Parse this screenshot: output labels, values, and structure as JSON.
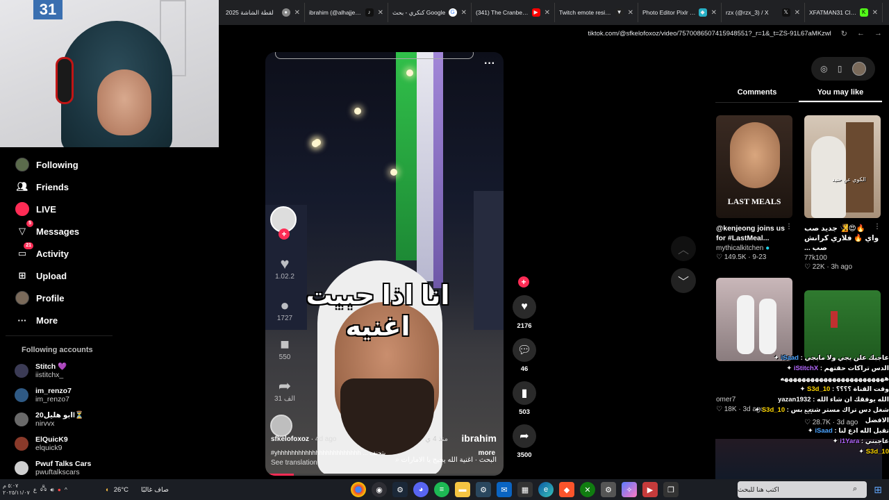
{
  "browser": {
    "tabs": [
      {
        "label": "لقطة الشاشة 2025",
        "icon": "chrome-icon",
        "color": "#888"
      },
      {
        "label": "ibrahim (@alhajjeri) |",
        "icon": "tiktok-icon",
        "color": "#111"
      },
      {
        "label": "كنكري - بحث Google",
        "icon": "google-icon",
        "color": "#4285f4"
      },
      {
        "label": "(341) The Cranberries",
        "icon": "youtube-icon",
        "color": "#ff0000"
      },
      {
        "label": "Twitch emote resizer",
        "icon": "resizer-icon",
        "color": "#111"
      },
      {
        "label": "Photo Editor Pixlr Free",
        "icon": "pixlr-icon",
        "color": "#27b0c6"
      },
      {
        "label": "rzx (@rzx_3) / X",
        "icon": "x-icon",
        "color": "#111"
      },
      {
        "label": "XFATMAN31 Clips - K",
        "icon": "kick-icon",
        "color": "#53fc18"
      }
    ],
    "url": "tiktok.com/@sfkelofoxoz/video/7570086507415948551?_r=1&_t=ZS-91L67aMKzwl"
  },
  "webcam": {
    "door_number": "31"
  },
  "sidebar": {
    "nav": [
      {
        "label": "Following",
        "icon": "following-avatar-icon",
        "badge": ""
      },
      {
        "label": "Friends",
        "icon": "friends-icon",
        "badge": ""
      },
      {
        "label": "LIVE",
        "icon": "live-icon",
        "badge": ""
      },
      {
        "label": "Messages",
        "icon": "messages-icon",
        "badge": "5"
      },
      {
        "label": "Activity",
        "icon": "activity-icon",
        "badge": "21"
      },
      {
        "label": "Upload",
        "icon": "upload-icon",
        "badge": ""
      },
      {
        "label": "Profile",
        "icon": "profile-avatar-icon",
        "badge": ""
      },
      {
        "label": "More",
        "icon": "more-icon",
        "badge": ""
      }
    ],
    "following_title": "Following accounts",
    "accounts": [
      {
        "name": "Stitch 💜",
        "handle": "iistitchx_"
      },
      {
        "name": "im_renzo7",
        "handle": "im_renzo7"
      },
      {
        "name": "ابو هليل20l⏳",
        "handle": "nirvvx"
      },
      {
        "name": "ElQuicK9",
        "handle": "elquick9"
      },
      {
        "name": "Pwuf Talks Cars",
        "handle": "pwuftalkscars"
      }
    ]
  },
  "video": {
    "caption": "انا اذا حبيت اغنيه",
    "author": "sfkelofoxoz",
    "posted": "4d ago",
    "watermark": "ibrahim",
    "watermark_sub": "منذ 4 ي",
    "description": "#yhhhhhhhhhhhhhhhhhhhhhhhh ... بتحنف",
    "more_label": "more",
    "translate_label": "See translation",
    "search_suggestion": "البحث · اغنية الله يحيج يا الامارات",
    "ghost_likes": "1.02.2",
    "ghost_comments": "1727",
    "ghost_saves": "550",
    "ghost_shares": "31 الف",
    "progress": 0.12
  },
  "actions": {
    "likes": "2176",
    "comments": "46",
    "saves": "503",
    "shares": "3500"
  },
  "right_panel": {
    "tabs": [
      "Comments",
      "You may like"
    ],
    "active_tab": "You may like",
    "cards": [
      {
        "title": "@kenjeong joins us for #LastMeal...",
        "author": "mythicalkitchen",
        "verified": true,
        "likes": "149.5K",
        "date": "9-23",
        "thumb_text": "LAST MEALS"
      },
      {
        "title": "🔥😍🧏 جديد صب واي 🔥 فلاري كرانش صب ...",
        "author": "77k100",
        "verified": false,
        "likes": "22K",
        "date": "3h ago",
        "thumb_text": "الكوي عن حنيد"
      },
      {
        "title": "",
        "author": "omer7",
        "verified": false,
        "likes": "18K",
        "date": "3d ago",
        "thumb_text": ""
      },
      {
        "title": "",
        "author": "el7",
        "verified": false,
        "likes": "28.7K",
        "date": "3d ago",
        "thumb_text": ""
      }
    ]
  },
  "chat": [
    {
      "user": "iSaad",
      "text": "عاجبك علن يجي ولا مايجي",
      "color": "u1"
    },
    {
      "user": "iStitchX",
      "text": "الدس تراكات حقتهم",
      "color": "u2"
    },
    {
      "user": "",
      "text": "ههههههههههههههههههههههههه",
      "color": "u4"
    },
    {
      "user": "S3d_10",
      "text": "وقت القناة ؟؟؟؟",
      "color": "u3"
    },
    {
      "user": "yazan1932",
      "text": "الله يوفقك ان شاء الله",
      "color": "u4"
    },
    {
      "user": "S3d_10",
      "text": "شغل دس تراك مستر شنب بس",
      "color": "u3"
    },
    {
      "user": "",
      "text": "الافضل",
      "color": "u4"
    },
    {
      "user": "iSaad",
      "text": "تقبل الله ادع لنا",
      "color": "u1"
    },
    {
      "user": "i1Yara",
      "text": "عاجبني",
      "color": "u2"
    },
    {
      "user": "S3d_10",
      "text": "",
      "color": "u3"
    }
  ],
  "taskbar": {
    "time": "٥:٠٧ م",
    "date": "٢٠٢٥/١١/٠٧",
    "weather_temp": "26°C",
    "weather_desc": "صاف غالبًا",
    "search_placeholder": "اكتب هنا للبحث",
    "apps": [
      "chrome-icon",
      "obs-icon",
      "steam-icon",
      "discord-icon",
      "spotify-icon",
      "folder-icon",
      "steam-alt-icon",
      "mail-icon",
      "store-icon",
      "edge-icon",
      "brave-icon",
      "xbox-icon",
      "settings-icon",
      "copilot-icon",
      "stream-icon",
      "taskview-icon"
    ]
  }
}
